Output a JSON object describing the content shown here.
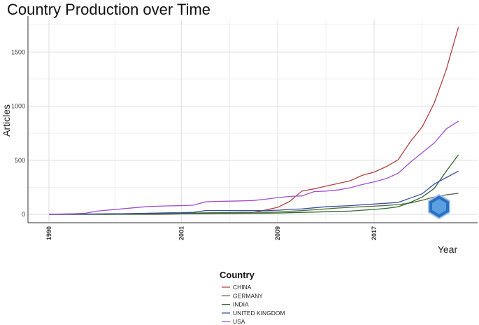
{
  "chart_data": {
    "type": "line",
    "title": "Country Production over Time",
    "xlabel": "Year",
    "ylabel": "Articles",
    "xlim": [
      1990,
      2024
    ],
    "ylim": [
      0,
      1750
    ],
    "x_ticks": [
      1990,
      2001,
      2009,
      2017
    ],
    "y_ticks": [
      0,
      500,
      1000,
      1500
    ],
    "grid": true,
    "legend": {
      "title": "Country",
      "placement": "bottom"
    },
    "x": [
      1990,
      1991,
      1992,
      1993,
      1994,
      1995,
      1996,
      1997,
      1998,
      1999,
      2000,
      2001,
      2002,
      2003,
      2004,
      2005,
      2006,
      2007,
      2008,
      2009,
      2010,
      2011,
      2012,
      2013,
      2014,
      2015,
      2016,
      2017,
      2018,
      2019,
      2020,
      2021,
      2022,
      2023,
      2024
    ],
    "series": [
      {
        "name": "CHINA",
        "color": "#b5403f",
        "values": [
          0,
          0,
          0,
          0,
          0,
          0,
          0,
          0,
          0,
          0,
          2,
          5,
          8,
          10,
          12,
          15,
          15,
          18,
          40,
          65,
          120,
          215,
          235,
          260,
          285,
          310,
          360,
          390,
          440,
          505,
          670,
          810,
          1030,
          1340,
          1730
        ]
      },
      {
        "name": "GERMANY",
        "color": "#556b3f",
        "values": [
          0,
          0,
          0,
          1,
          2,
          3,
          4,
          5,
          6,
          7,
          8,
          10,
          12,
          14,
          15,
          17,
          18,
          19,
          20,
          22,
          28,
          35,
          42,
          50,
          58,
          65,
          70,
          75,
          82,
          90,
          105,
          130,
          160,
          180,
          195
        ]
      },
      {
        "name": "INDIA",
        "color": "#2f6b2f",
        "values": [
          0,
          0,
          0,
          0,
          0,
          0,
          1,
          1,
          2,
          2,
          3,
          4,
          5,
          6,
          7,
          8,
          9,
          10,
          11,
          12,
          15,
          18,
          21,
          24,
          27,
          30,
          38,
          45,
          55,
          70,
          110,
          160,
          240,
          400,
          550
        ]
      },
      {
        "name": "UNITED KINGDOM",
        "color": "#3a4fa0",
        "values": [
          0,
          1,
          2,
          3,
          4,
          5,
          6,
          8,
          10,
          12,
          14,
          15,
          18,
          35,
          35,
          35,
          35,
          35,
          35,
          38,
          45,
          50,
          60,
          70,
          75,
          80,
          88,
          95,
          102,
          110,
          150,
          190,
          280,
          340,
          400
        ]
      },
      {
        "name": "USA",
        "color": "#a04fd0",
        "values": [
          0,
          3,
          5,
          10,
          30,
          40,
          50,
          60,
          70,
          75,
          78,
          80,
          85,
          115,
          120,
          122,
          124,
          128,
          140,
          155,
          165,
          170,
          210,
          215,
          225,
          245,
          275,
          300,
          330,
          380,
          480,
          570,
          660,
          790,
          860
        ]
      }
    ]
  }
}
